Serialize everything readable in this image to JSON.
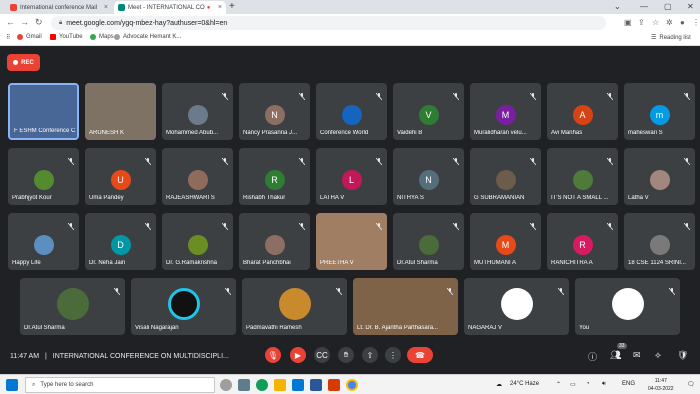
{
  "browser": {
    "tabs": [
      {
        "title": "International conference Mail",
        "fav_color": "#ea4335"
      },
      {
        "title": "Meet - INTERNATIONAL CO",
        "fav_color": "#00897b"
      }
    ],
    "url": "meet.google.com/ygq-mbez-hay?authuser=0&hl=en",
    "bookmarks": [
      "Gmail",
      "YouTube",
      "Maps",
      "Advocate Hemant K..."
    ],
    "reading_list": "Reading list"
  },
  "meet": {
    "rec_label": "REC",
    "time": "11:47 AM",
    "separator": "|",
    "meeting_title": "INTERNATIONAL CONFERENCE ON MULTIDISCIPLI...",
    "participant_count": "33",
    "tiles": [
      {
        "name": "F ESHM Conference C",
        "avatar": "",
        "color": "#4a6fa5"
      },
      {
        "name": "ARUNESH K",
        "avatar": "",
        "color": "#8a7b6b"
      },
      {
        "name": "Mohammed Abub...",
        "avatar": "",
        "color": "#6b7b8c"
      },
      {
        "name": "Nancy Prasanna J...",
        "avatar": "N",
        "color": "#8d6e63"
      },
      {
        "name": "Conference World",
        "avatar": "",
        "color": "#1565c0"
      },
      {
        "name": "Vaidehi B",
        "avatar": "V",
        "color": "#2e7d32"
      },
      {
        "name": "Muralidharan velu...",
        "avatar": "M",
        "color": "#7b1fa2"
      },
      {
        "name": "Avi Manhas",
        "avatar": "A",
        "color": "#d84315"
      },
      {
        "name": "maheswari S",
        "avatar": "m",
        "color": "#039be5"
      },
      {
        "name": "Prabhjyot Kour",
        "avatar": "",
        "color": "#558b2f"
      },
      {
        "name": "Uma Pandey",
        "avatar": "U",
        "color": "#e64a19"
      },
      {
        "name": "RAJEASHWARI S",
        "avatar": "",
        "color": "#8e6b5a"
      },
      {
        "name": "Rishabh Thakur",
        "avatar": "R",
        "color": "#2e7d32"
      },
      {
        "name": "LATHA V",
        "avatar": "L",
        "color": "#c2185b"
      },
      {
        "name": "NITHYA S",
        "avatar": "N",
        "color": "#546e7a"
      },
      {
        "name": "G SUBRAMANIAN",
        "avatar": "",
        "color": "#6d5b4b"
      },
      {
        "name": "IT'S NOT A SMALL ...",
        "avatar": "",
        "color": "#4e7a3a"
      },
      {
        "name": "Latha V",
        "avatar": "",
        "color": "#a1887f"
      },
      {
        "name": "Happy Life",
        "avatar": "",
        "color": "#5c8fbf"
      },
      {
        "name": "Dr. Neha Jain",
        "avatar": "D",
        "color": "#0097a7"
      },
      {
        "name": "Dr. G.Ramakrishna",
        "avatar": "",
        "color": "#6b8e23"
      },
      {
        "name": "Bharat Panchbhai",
        "avatar": "",
        "color": "#8d6e63"
      },
      {
        "name": "PREETHA V",
        "avatar": "",
        "color": "#b08968"
      },
      {
        "name": "Dr.Atul Sharma",
        "avatar": "",
        "color": "#4b6b3b"
      },
      {
        "name": "MUTHUMANI A",
        "avatar": "M",
        "color": "#e64a19"
      },
      {
        "name": "RANICHITRA A",
        "avatar": "R",
        "color": "#d81b60"
      },
      {
        "name": "18 CSE 1124 SRINI...",
        "avatar": "",
        "color": "#7a7a7a"
      },
      {
        "name": "Dr.Atul Sharma",
        "avatar": "",
        "color": "#4b6b3b"
      },
      {
        "name": "Visali Nagarajan",
        "avatar": "",
        "color": "#111111"
      },
      {
        "name": "Padmavathi Ramesh",
        "avatar": "",
        "color": "#c98a2e"
      },
      {
        "name": "Lt. Dr. B. Ajantha Parthasara...",
        "avatar": "",
        "color": "#8a6a4a"
      },
      {
        "name": "NAGARAJ V",
        "avatar": "",
        "color": "#ffffff"
      },
      {
        "name": "You",
        "avatar": "",
        "color": "#ffffff"
      }
    ]
  },
  "taskbar": {
    "search_placeholder": "Type here to search",
    "weather": "24°C  Haze",
    "lang": "ENG",
    "time": "11:47",
    "date": "04-03-2022"
  }
}
